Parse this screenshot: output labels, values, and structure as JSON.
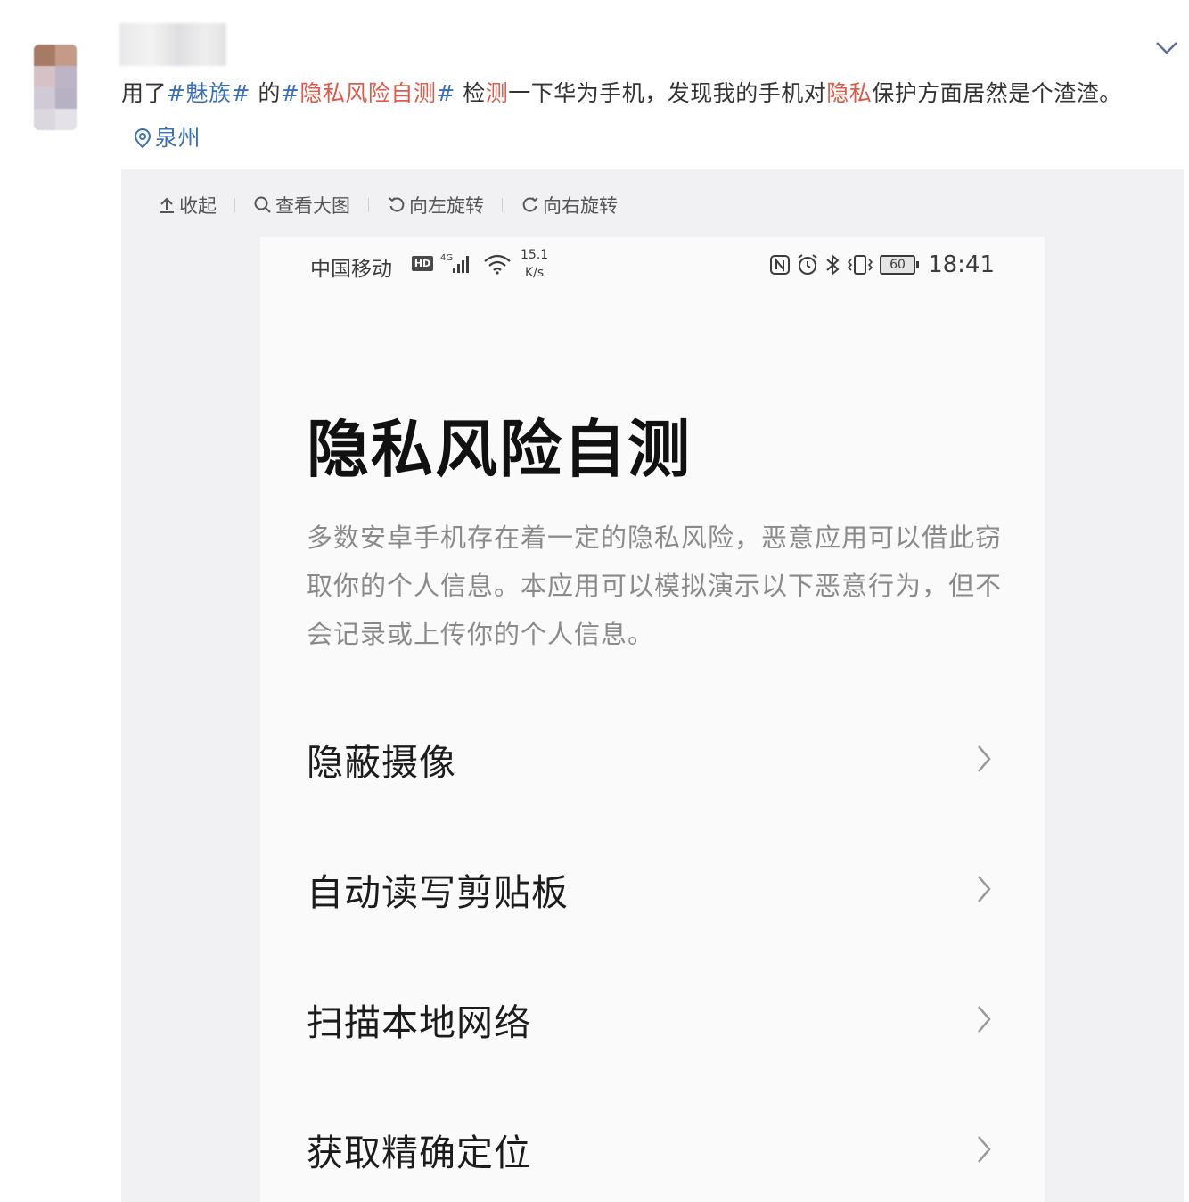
{
  "post": {
    "text_part1": "用了",
    "tag1": "#魅族#",
    "text_part2": " 的",
    "tag2_hash_open": "#",
    "tag2_keyword": "隐私风险自测",
    "tag2_hash_close": "#",
    "text_part3": " 检",
    "kw_ce": "测",
    "text_part4": "一下华为手机，发现我的手机对",
    "kw_yinsi": "隐私",
    "text_part5": "保护方面居然是个渣渣。",
    "location": "泉州"
  },
  "toolbar": {
    "collapse": "收起",
    "view_large": "查看大图",
    "rotate_left": "向左旋转",
    "rotate_right": "向右旋转"
  },
  "phone": {
    "status": {
      "carrier": "中国移动",
      "hd": "HD",
      "network": "4G",
      "speed_value": "15.1",
      "speed_unit": "K/s",
      "battery": "60",
      "time": "18:41"
    },
    "title": "隐私风险自测",
    "description": "多数安卓手机存在着一定的隐私风险，恶意应用可以借此窃取你的个人信息。本应用可以模拟演示以下恶意行为，但不会记录或上传你的个人信息。",
    "menu": [
      {
        "label": "隐蔽摄像"
      },
      {
        "label": "自动读写剪贴板"
      },
      {
        "label": "扫描本地网络"
      },
      {
        "label": "获取精确定位"
      }
    ]
  },
  "colors": {
    "link": "#3a6fb5",
    "keyword": "#e05a4a"
  }
}
